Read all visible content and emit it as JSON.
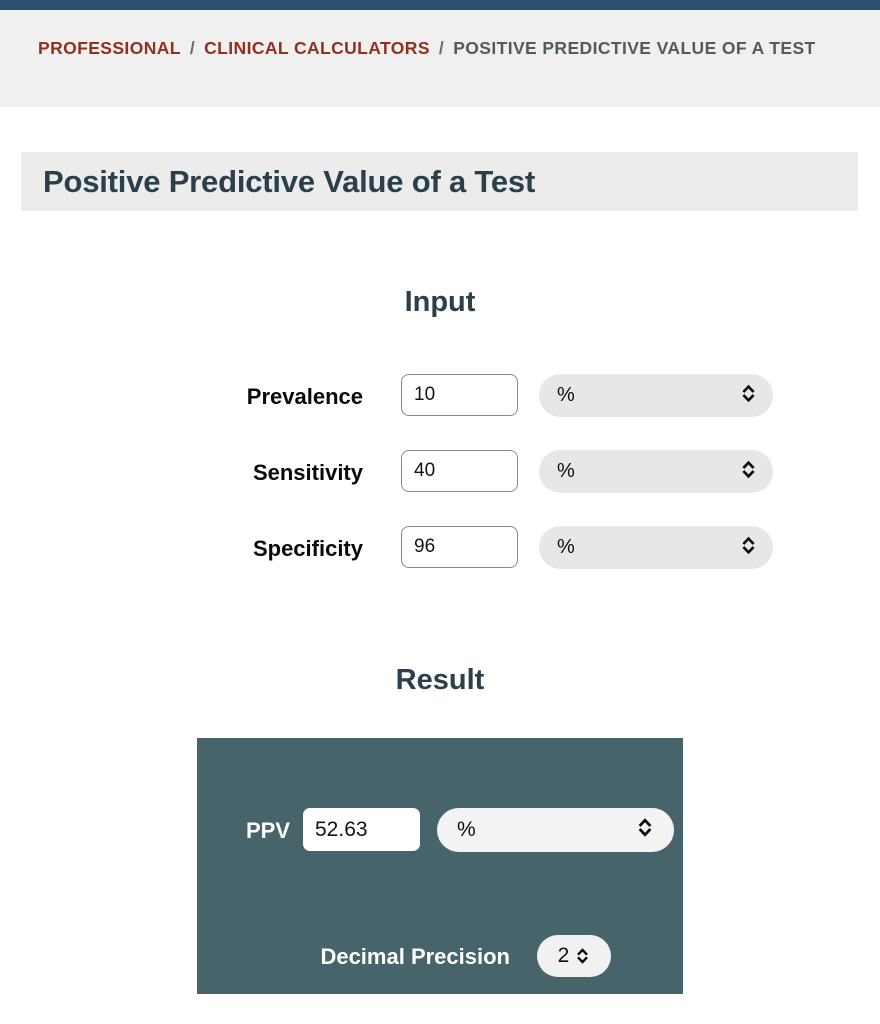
{
  "breadcrumb": {
    "items": [
      {
        "label": "PROFESSIONAL",
        "type": "link"
      },
      {
        "label": "CLINICAL CALCULATORS",
        "type": "link"
      },
      {
        "label": "POSITIVE PREDICTIVE VALUE OF A TEST",
        "type": "current"
      }
    ],
    "separator": "/"
  },
  "page": {
    "title": "Positive Predictive Value of a Test"
  },
  "input_section": {
    "heading": "Input",
    "rows": [
      {
        "label": "Prevalence",
        "value": "10",
        "unit": "%",
        "icon": "chevron-updown-icon"
      },
      {
        "label": "Sensitivity",
        "value": "40",
        "unit": "%",
        "icon": "chevron-updown-icon"
      },
      {
        "label": "Specificity",
        "value": "96",
        "unit": "%",
        "icon": "chevron-updown-icon"
      }
    ]
  },
  "result_section": {
    "heading": "Result",
    "ppv": {
      "label": "PPV",
      "value": "52.63",
      "unit": "%",
      "icon": "chevron-updown-icon"
    },
    "precision": {
      "label": "Decimal Precision",
      "value": "2",
      "icon": "chevron-updown-icon"
    }
  },
  "colors": {
    "topbar": "#2d5071",
    "breadcrumb_link": "#92301f",
    "breadcrumb_current": "#555a5d",
    "heading": "#2b4049",
    "result_panel": "#47646a",
    "header_band": "#f0f0f0",
    "title_band": "#ececec"
  }
}
